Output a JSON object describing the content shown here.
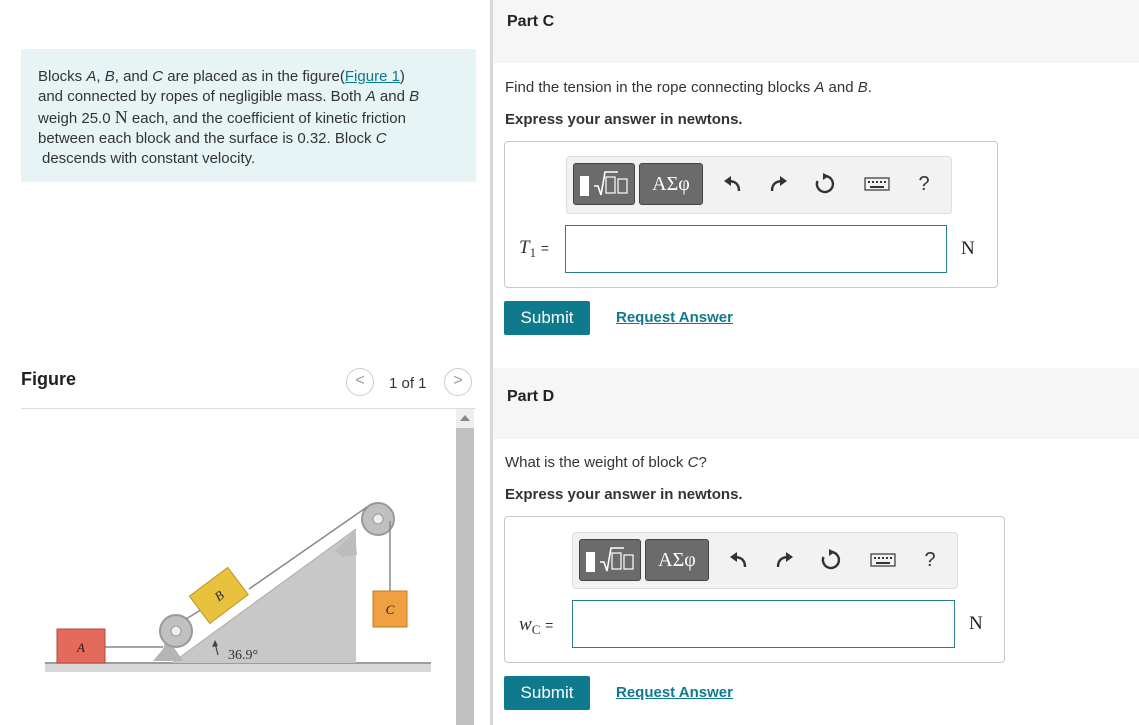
{
  "problem": {
    "line1_a": "Blocks ",
    "A": "A",
    "comma1": ", ",
    "B": "B",
    "comma2": ", and ",
    "C": "C",
    "line1_b": " are placed as in the figure(",
    "figure_link": "Figure 1",
    "line1_c": ")",
    "line2_a": "and connected by ropes of negligible mass. Both ",
    "line2_and": " and ",
    "line3_a": "weigh 25.0 ",
    "unitN": "N",
    "line3_b": " each, and the coefficient of kinetic friction",
    "line4": "between each block and the surface is 0.32. Block ",
    "line5": "descends with constant velocity."
  },
  "figure": {
    "title": "Figure",
    "pager": "1 of 1",
    "prev_glyph": "<",
    "next_glyph": ">",
    "block_a": "A",
    "block_b": "B",
    "block_c": "C",
    "angle": "36.9°"
  },
  "partC": {
    "title": "Part C",
    "question_a": "Find the tension in the rope connecting blocks ",
    "q_A": "A",
    "question_and": " and ",
    "q_B": "B",
    "question_end": ".",
    "express": "Express your answer in newtons.",
    "var": "T",
    "var_sub": "1",
    "eq": "=",
    "unit": "N",
    "submit": "Submit",
    "request": "Request Answer",
    "input_value": ""
  },
  "partD": {
    "title": "Part D",
    "question_a": "What is the weight of block ",
    "q_C": "C",
    "question_end": "?",
    "express": "Express your answer in newtons.",
    "var": "w",
    "var_sub": "C",
    "eq": "=",
    "unit": "N",
    "submit": "Submit",
    "request": "Request Answer",
    "input_value": ""
  },
  "toolbar": {
    "greek": "ΑΣφ",
    "help": "?",
    "icons": [
      "templates-icon",
      "greek-icon",
      "undo-icon",
      "redo-icon",
      "reset-icon",
      "keyboard-icon",
      "help-icon"
    ]
  },
  "colors": {
    "accent": "#0f7a8e",
    "problem_bg": "#e6f4f5",
    "block_a": "#e46a5c",
    "block_b": "#e8c23c",
    "block_c": "#f0a040"
  }
}
